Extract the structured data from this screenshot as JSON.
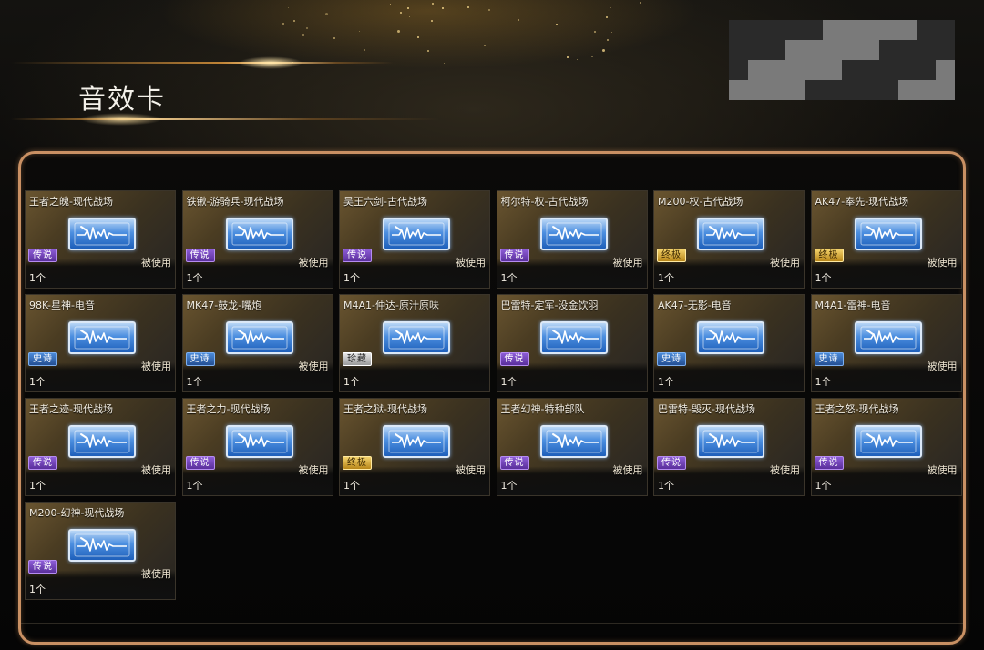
{
  "page": {
    "title": "音效卡"
  },
  "colors": {
    "panel_border": "#c99063",
    "accent_gold": "#f3d58a"
  },
  "cards": [
    {
      "name": "王者之魄-现代战场",
      "rarity": "传说",
      "rarity_color": "purple",
      "status": "被使用",
      "quantity": "1个"
    },
    {
      "name": "铁锹-游骑兵-现代战场",
      "rarity": "传说",
      "rarity_color": "purple",
      "status": "被使用",
      "quantity": "1个"
    },
    {
      "name": "吴王六剑-古代战场",
      "rarity": "传说",
      "rarity_color": "purple",
      "status": "被使用",
      "quantity": "1个"
    },
    {
      "name": "柯尔特-权-古代战场",
      "rarity": "传说",
      "rarity_color": "purple",
      "status": "被使用",
      "quantity": "1个"
    },
    {
      "name": "M200-权-古代战场",
      "rarity": "终极",
      "rarity_color": "gold",
      "status": "被使用",
      "quantity": "1个"
    },
    {
      "name": "AK47-奉先-现代战场",
      "rarity": "终极",
      "rarity_color": "gold",
      "status": "被使用",
      "quantity": "1个"
    },
    {
      "name": "98K-星神-电音",
      "rarity": "史诗",
      "rarity_color": "blue",
      "status": "被使用",
      "quantity": "1个"
    },
    {
      "name": "MK47-鼓龙-嘴炮",
      "rarity": "史诗",
      "rarity_color": "blue",
      "status": "被使用",
      "quantity": "1个"
    },
    {
      "name": "M4A1-仲达-原汁原味",
      "rarity": "珍藏",
      "rarity_color": "silver",
      "status": "",
      "quantity": "1个"
    },
    {
      "name": "巴雷特-定军-没金饮羽",
      "rarity": "传说",
      "rarity_color": "purple",
      "status": "",
      "quantity": "1个"
    },
    {
      "name": "AK47-无影-电音",
      "rarity": "史诗",
      "rarity_color": "blue",
      "status": "",
      "quantity": "1个"
    },
    {
      "name": "M4A1-雷神-电音",
      "rarity": "史诗",
      "rarity_color": "blue",
      "status": "被使用",
      "quantity": "1个"
    },
    {
      "name": "王者之迹-现代战场",
      "rarity": "传说",
      "rarity_color": "purple",
      "status": "被使用",
      "quantity": "1个"
    },
    {
      "name": "王者之力-现代战场",
      "rarity": "传说",
      "rarity_color": "purple",
      "status": "被使用",
      "quantity": "1个"
    },
    {
      "name": "王者之狱-现代战场",
      "rarity": "终极",
      "rarity_color": "gold",
      "status": "被使用",
      "quantity": "1个"
    },
    {
      "name": "王者幻神-特种部队",
      "rarity": "传说",
      "rarity_color": "purple",
      "status": "被使用",
      "quantity": "1个"
    },
    {
      "name": "巴雷特-毁灭-现代战场",
      "rarity": "传说",
      "rarity_color": "purple",
      "status": "被使用",
      "quantity": "1个"
    },
    {
      "name": "王者之怒-现代战场",
      "rarity": "传说",
      "rarity_color": "purple",
      "status": "被使用",
      "quantity": "1个"
    },
    {
      "name": "M200-幻神-现代战场",
      "rarity": "传说",
      "rarity_color": "purple",
      "status": "被使用",
      "quantity": "1个"
    }
  ]
}
